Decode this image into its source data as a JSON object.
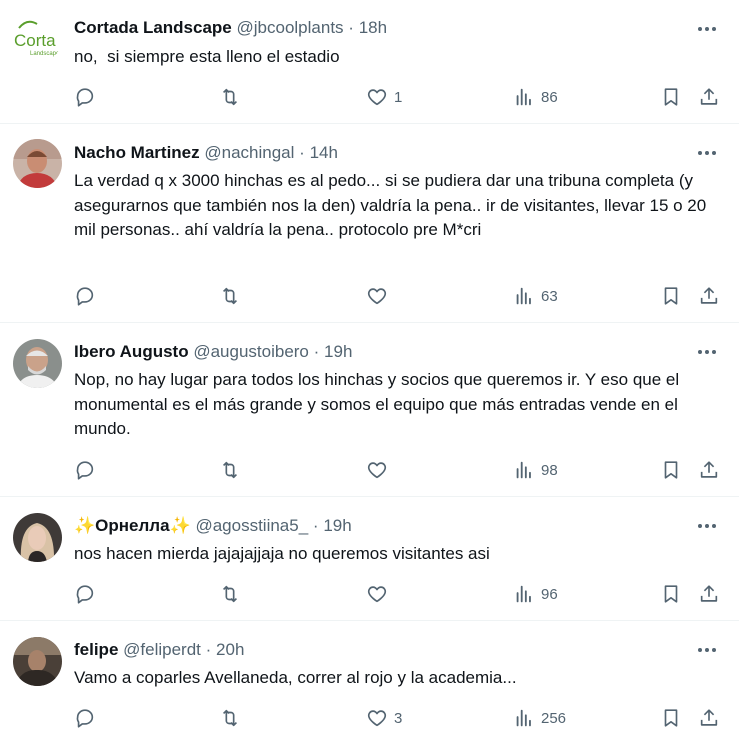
{
  "tweets": [
    {
      "name": "Cortada Landscape",
      "handle": "@jbcoolplants",
      "time": "18h",
      "text": "no,  si siempre esta lleno el estadio",
      "likes": "1",
      "views": "86",
      "avatar_logo": {
        "word": "Corta",
        "sub": "Landscape"
      }
    },
    {
      "name": "Nacho Martinez",
      "handle": "@nachingal",
      "time": "14h",
      "text": "La verdad q x 3000 hinchas es al pedo... si se pudiera dar una tribuna completa (y asegurarnos que también nos la den) valdría la pena.. ir de visitantes, llevar 15 o 20 mil personas.. ahí valdría la pena.. protocolo pre M*cri",
      "likes": "",
      "views": "63"
    },
    {
      "name": "Ibero Augusto",
      "handle": "@augustoibero",
      "time": "19h",
      "text": "Nop, no hay lugar para todos los hinchas y socios que queremos ir. Y eso que el monumental es el más grande y somos el equipo que más entradas vende en el mundo.",
      "likes": "",
      "views": "98"
    },
    {
      "name": "✨Орнелла✨",
      "handle": "@agosstiina5_",
      "time": "19h",
      "text": "nos hacen mierda jajajajjaja no queremos visitantes asi",
      "likes": "",
      "views": "96"
    },
    {
      "name": "felipe",
      "handle": "@feliperdt",
      "time": "20h",
      "text": "Vamo a coparles Avellaneda, correr al rojo y la academia...",
      "likes": "3",
      "views": "256"
    }
  ],
  "separator": "·",
  "colors": {
    "text": "#0f1419",
    "muted": "#536471",
    "divider": "#eff3f4",
    "logo_green": "#5a9e2c"
  }
}
